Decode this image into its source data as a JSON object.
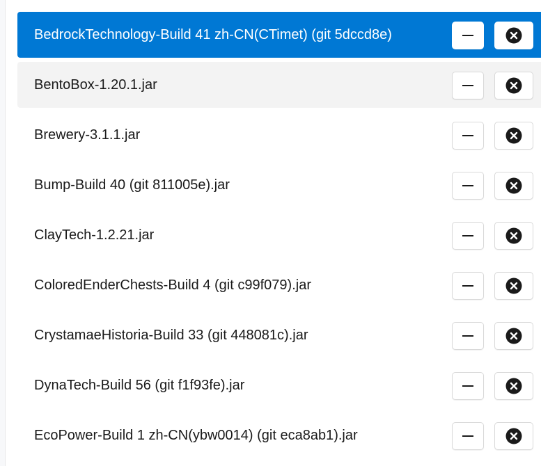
{
  "colors": {
    "selected_background": "#0078d4",
    "hover_background": "#f3f3f3",
    "text": "#1a1a1a",
    "selected_text": "#ffffff"
  },
  "icons": {
    "disable": "minus-icon",
    "remove": "close-circle-icon"
  },
  "plugins": [
    {
      "name": "BedrockTechnology-Build 41 zh-CN(CTimet) (git 5dccd8e)",
      "state": "selected"
    },
    {
      "name": "BentoBox-1.20.1.jar",
      "state": "hover"
    },
    {
      "name": "Brewery-3.1.1.jar",
      "state": "normal"
    },
    {
      "name": "Bump-Build 40 (git 811005e).jar",
      "state": "normal"
    },
    {
      "name": "ClayTech-1.2.21.jar",
      "state": "normal"
    },
    {
      "name": "ColoredEnderChests-Build 4 (git c99f079).jar",
      "state": "normal"
    },
    {
      "name": "CrystamaeHistoria-Build 33 (git 448081c).jar",
      "state": "normal"
    },
    {
      "name": "DynaTech-Build 56 (git f1f93fe).jar",
      "state": "normal"
    },
    {
      "name": "EcoPower-Build 1 zh-CN(ybw0014) (git eca8ab1).jar",
      "state": "normal"
    }
  ]
}
